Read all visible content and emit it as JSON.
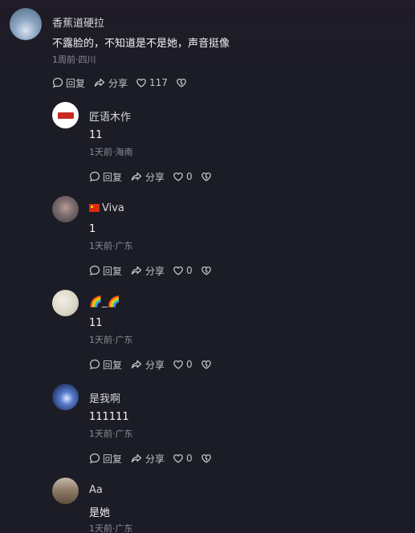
{
  "root": {
    "username": "香蕉道硬拉",
    "text": "不露脸的，不知道是不是她，声音挺像",
    "meta": "1周前·四川",
    "reply_label": "回复",
    "share_label": "分享",
    "like_count": "117"
  },
  "replies": [
    {
      "username": "匠语木作",
      "text": "11",
      "meta": "1天前·海南",
      "reply_label": "回复",
      "share_label": "分享",
      "like_count": "0"
    },
    {
      "username": "Viva",
      "text": "1",
      "meta": "1天前·广东",
      "reply_label": "回复",
      "share_label": "分享",
      "like_count": "0"
    },
    {
      "username": "🌈_🌈",
      "text": "11",
      "meta": "1天前·广东",
      "reply_label": "回复",
      "share_label": "分享",
      "like_count": "0"
    },
    {
      "username": "是我啊",
      "text": "111111",
      "meta": "1天前·广东",
      "reply_label": "回复",
      "share_label": "分享",
      "like_count": "0"
    },
    {
      "username": "Aa",
      "text": "是她",
      "meta": "1天前·广东"
    }
  ],
  "colors": {
    "background": "#1c1c26",
    "meta_text": "#8b8b96",
    "flag_red": "#de2910"
  },
  "icons": [
    "reply-bubble-icon",
    "share-arrow-icon",
    "heart-icon",
    "broken-heart-icon",
    "china-flag-icon"
  ]
}
